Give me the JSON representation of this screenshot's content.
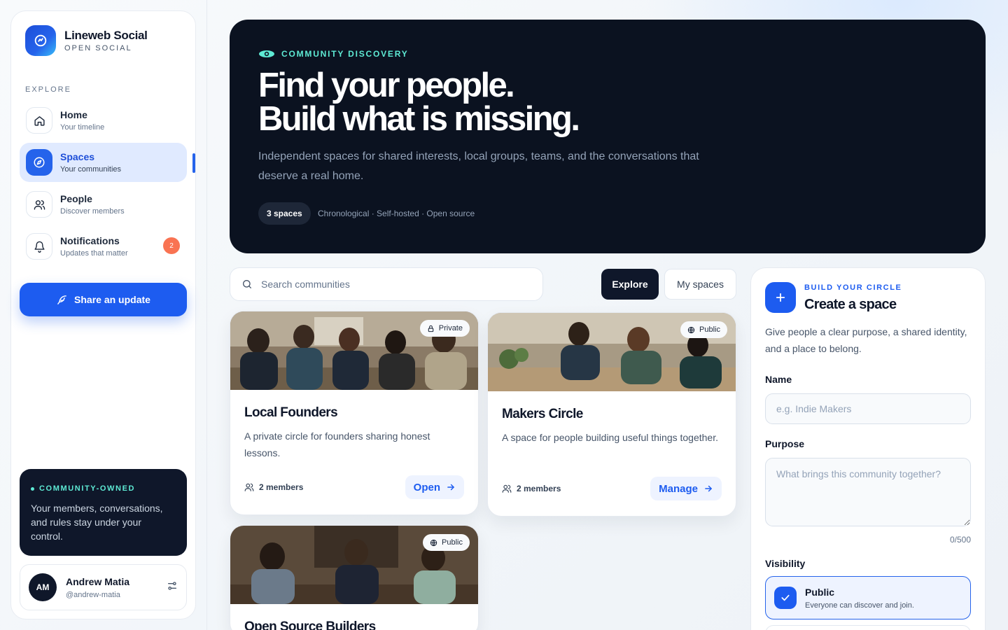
{
  "brand": {
    "title": "Lineweb Social",
    "subtitle": "OPEN SOCIAL"
  },
  "sidebar": {
    "section_label": "EXPLORE",
    "items": [
      {
        "title": "Home",
        "subtitle": "Your timeline",
        "icon": "home-icon"
      },
      {
        "title": "Spaces",
        "subtitle": "Your communities",
        "icon": "compass-icon",
        "active": true
      },
      {
        "title": "People",
        "subtitle": "Discover members",
        "icon": "users-icon"
      },
      {
        "title": "Notifications",
        "subtitle": "Updates that matter",
        "icon": "bell-icon",
        "badge": "2"
      }
    ],
    "share_label": "Share an update",
    "owned": {
      "tag": "COMMUNITY-OWNED",
      "text": "Your members, conversations, and rules stay under your control."
    },
    "user": {
      "initials": "AM",
      "name": "Andrew Matia",
      "handle": "@andrew-matia"
    }
  },
  "hero": {
    "tag": "COMMUNITY DISCOVERY",
    "title_line1": "Find your people.",
    "title_line2": "Build what is missing.",
    "description": "Independent spaces for shared interests, local groups, teams, and the conversations that deserve a real home.",
    "pill": "3 spaces",
    "meta": "Chronological · Self-hosted · Open source"
  },
  "search": {
    "placeholder": "Search communities"
  },
  "tabs": {
    "explore": "Explore",
    "my_spaces": "My spaces"
  },
  "cards": [
    {
      "title": "Local Founders",
      "description": "A private circle for founders sharing honest lessons.",
      "visibility": "Private",
      "members": "2 members",
      "action": "Open"
    },
    {
      "title": "Makers Circle",
      "description": "A space for people building useful things together.",
      "visibility": "Public",
      "members": "2 members",
      "action": "Manage"
    },
    {
      "title": "Open Source Builders",
      "visibility": "Public"
    }
  ],
  "create": {
    "tag": "BUILD YOUR CIRCLE",
    "title": "Create a space",
    "description": "Give people a clear purpose, a shared identity, and a place to belong.",
    "name_label": "Name",
    "name_placeholder": "e.g. Indie Makers",
    "purpose_label": "Purpose",
    "purpose_placeholder": "What brings this community together?",
    "counter": "0/500",
    "visibility_label": "Visibility",
    "visibility_option": {
      "title": "Public",
      "subtitle": "Everyone can discover and join."
    }
  },
  "colors": {
    "accent": "#1d5cf0",
    "hero_bg": "#0b1220",
    "teal": "#5eead4",
    "badge": "#f97352"
  }
}
